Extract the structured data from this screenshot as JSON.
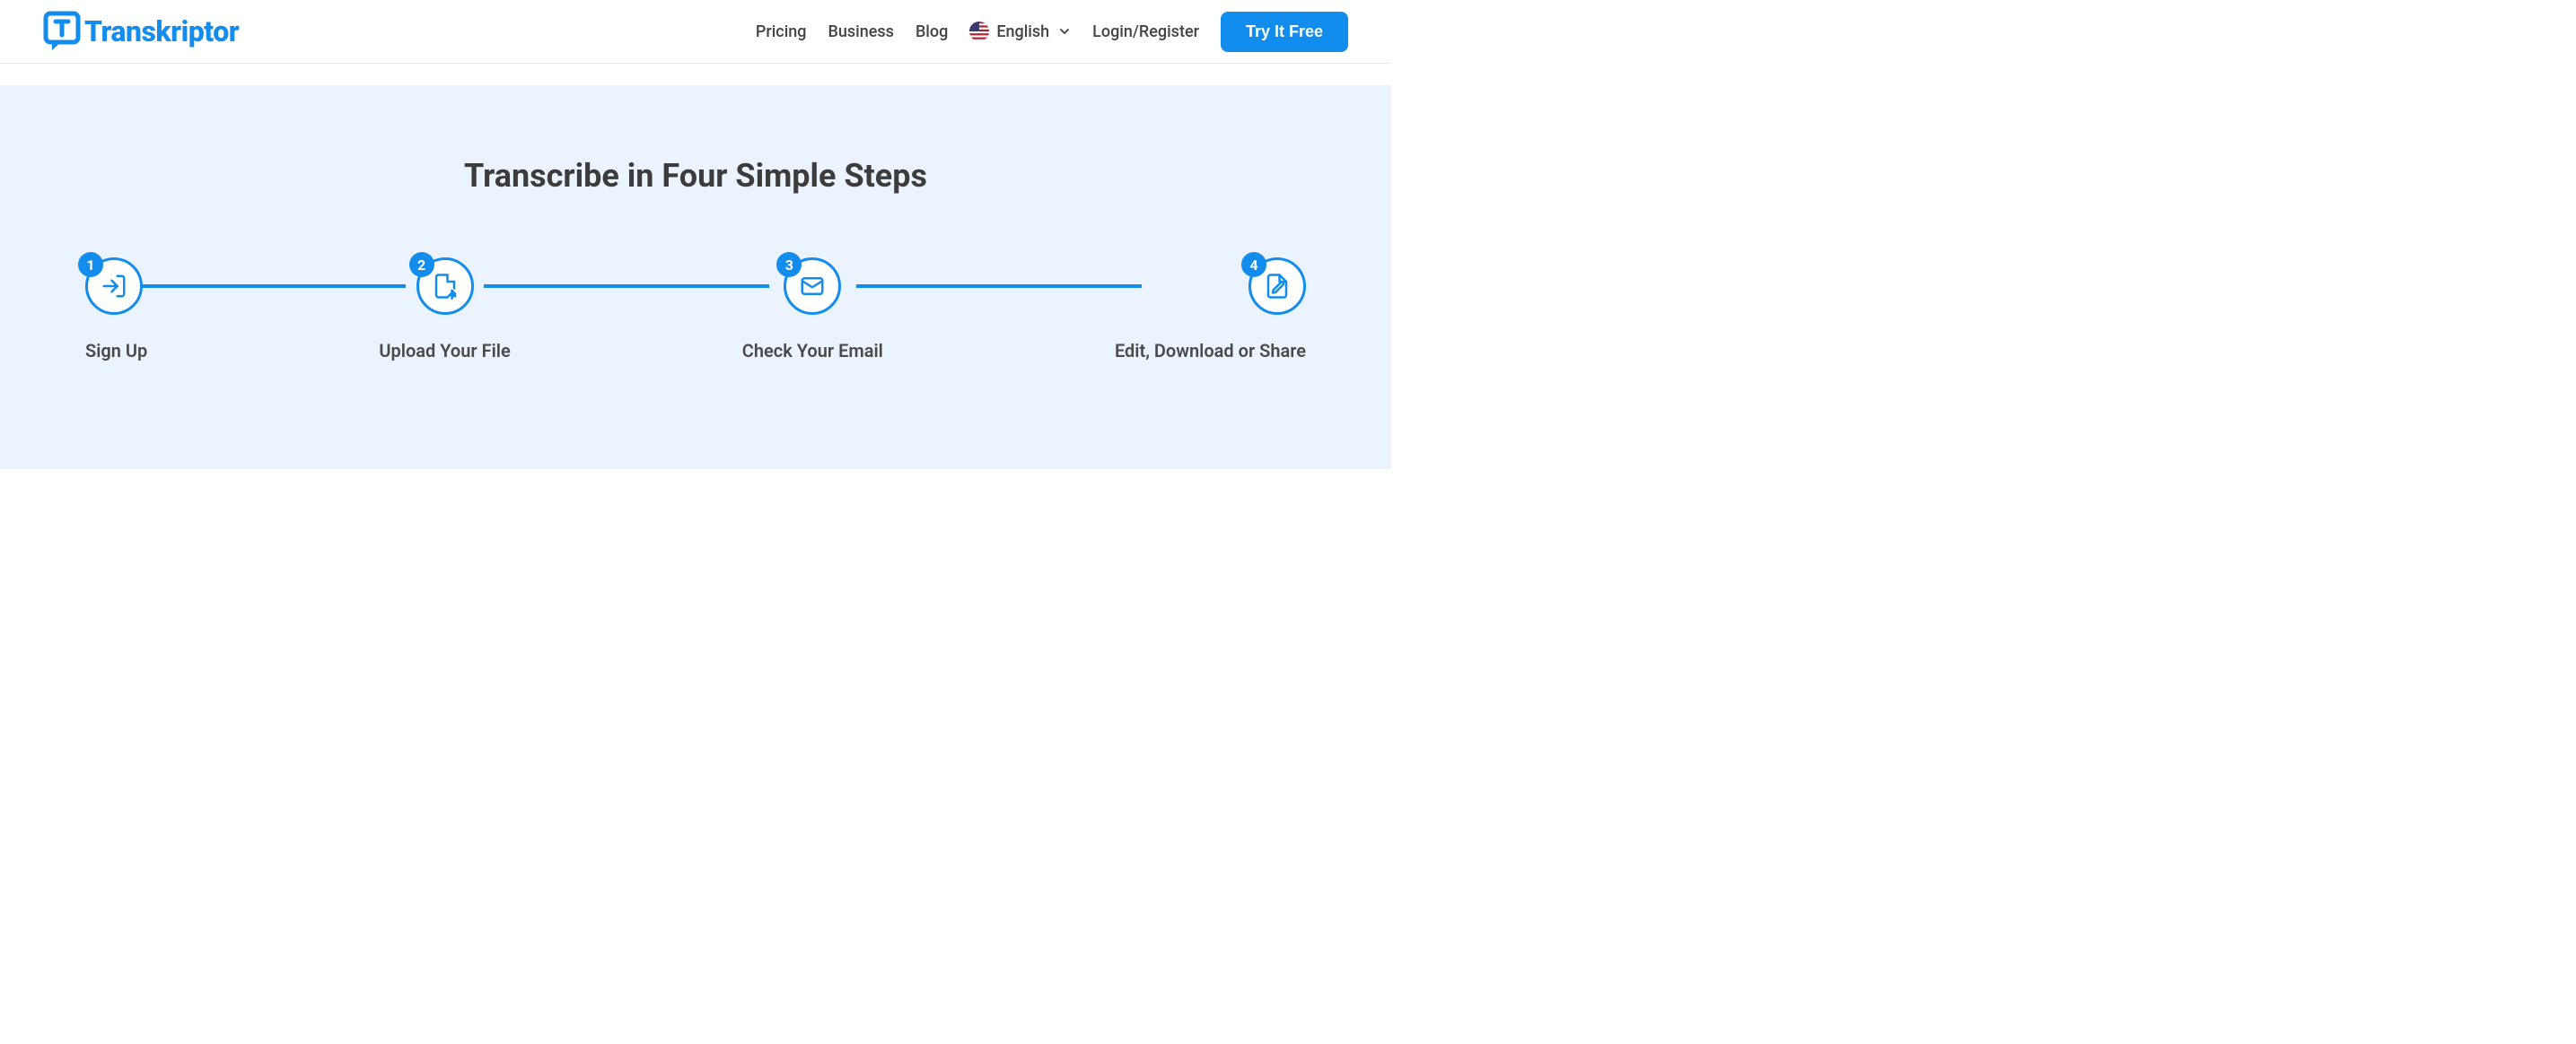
{
  "brand": "Transkriptor",
  "nav": {
    "pricing": "Pricing",
    "business": "Business",
    "blog": "Blog",
    "language": "English",
    "login": "Login/Register",
    "cta": "Try It Free"
  },
  "hero": {
    "title": "Transcribe in Four Simple Steps"
  },
  "steps": [
    {
      "num": "1",
      "label": "Sign Up"
    },
    {
      "num": "2",
      "label": "Upload Your File"
    },
    {
      "num": "3",
      "label": "Check Your Email"
    },
    {
      "num": "4",
      "label": "Edit, Download or Share"
    }
  ],
  "colors": {
    "accent": "#128ced",
    "hero_bg": "#eaf3fe"
  }
}
